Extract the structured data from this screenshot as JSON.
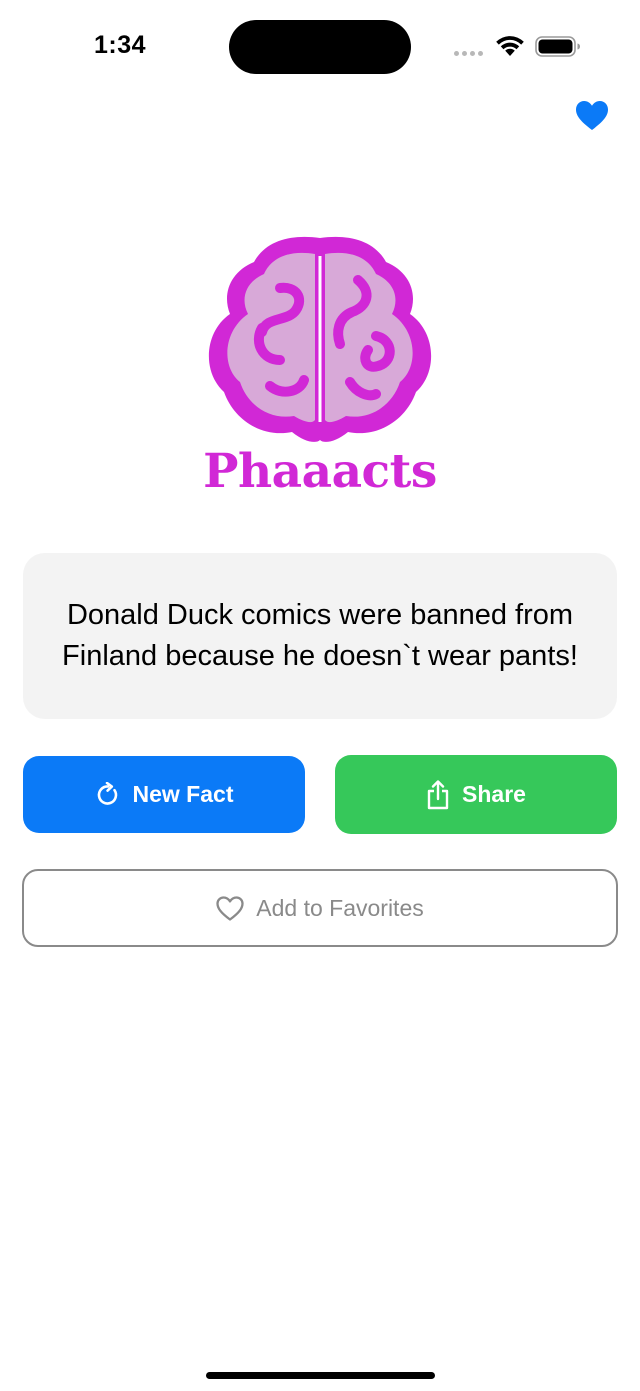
{
  "status_bar": {
    "time": "1:34",
    "icons": [
      "signal-icon",
      "wifi-icon",
      "battery-icon"
    ]
  },
  "nav": {
    "favorites_icon": "heart-filled-icon",
    "accent_color": "#0b7af7"
  },
  "logo": {
    "icon": "brain-icon",
    "brand_color": "#d128d6",
    "brain_fill_color": "#d8a9d8",
    "wordmark": "Phaaacts"
  },
  "fact": {
    "text": "Donald Duck comics were banned from Finland because he doesn`t wear pants!",
    "card_color": "#f3f3f3"
  },
  "actions": {
    "new_fact": {
      "label": "New Fact",
      "icon": "refresh-icon",
      "color": "#0b7af7"
    },
    "share": {
      "label": "Share",
      "icon": "share-icon",
      "color": "#36c85a"
    },
    "add_favorite": {
      "label": "Add to Favorites",
      "icon": "heart-outline-icon",
      "color": "#8a8a8a"
    }
  }
}
